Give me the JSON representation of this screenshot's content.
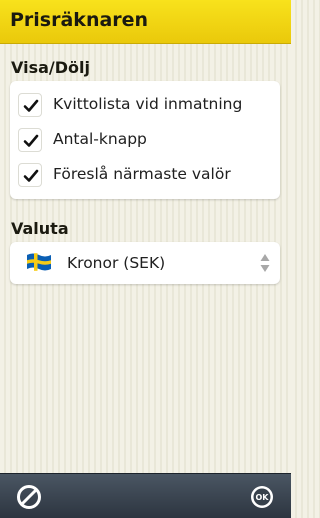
{
  "header": {
    "title": "Prisräknaren"
  },
  "visibility": {
    "title": "Visa/Dölj",
    "options": [
      {
        "label": "Kvittolista vid inmatning",
        "checked": true
      },
      {
        "label": "Antal-knapp",
        "checked": true
      },
      {
        "label": "Föreslå närmaste valör",
        "checked": true
      }
    ]
  },
  "currency": {
    "title": "Valuta",
    "selected": "Kronor (SEK)",
    "flag_icon": "sweden-flag-icon"
  },
  "toolbar": {
    "cancel_icon": "cancel-icon",
    "ok_icon": "ok-icon",
    "ok_label": "OK"
  },
  "colors": {
    "header": "#f5d812",
    "bottom_bar": "#3a4450",
    "background": "#f1efe3"
  }
}
